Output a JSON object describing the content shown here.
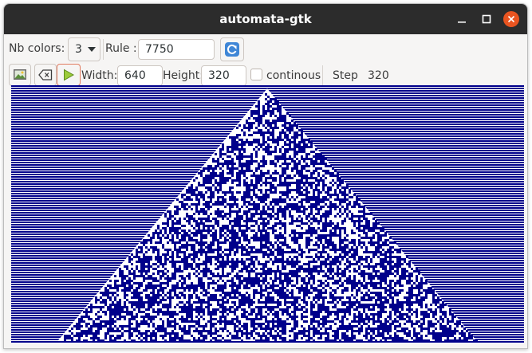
{
  "window": {
    "title": "automata-gtk"
  },
  "toolbar1": {
    "nb_colors_label": "Nb colors:",
    "nb_colors_value": "3",
    "rule_label": "Rule :",
    "rule_value": "7750"
  },
  "toolbar2": {
    "width_label": "Width:",
    "width_value": "640",
    "height_label": "Height:",
    "height_value": "320",
    "continous_label": "continous",
    "continous_checked": false,
    "step_label": "Step",
    "step_value": "320"
  },
  "colors": {
    "cell_dark": "#00008b",
    "cell_light": "#ffffff",
    "titlebar": "#2c2c2c",
    "close_button": "#e95420"
  }
}
